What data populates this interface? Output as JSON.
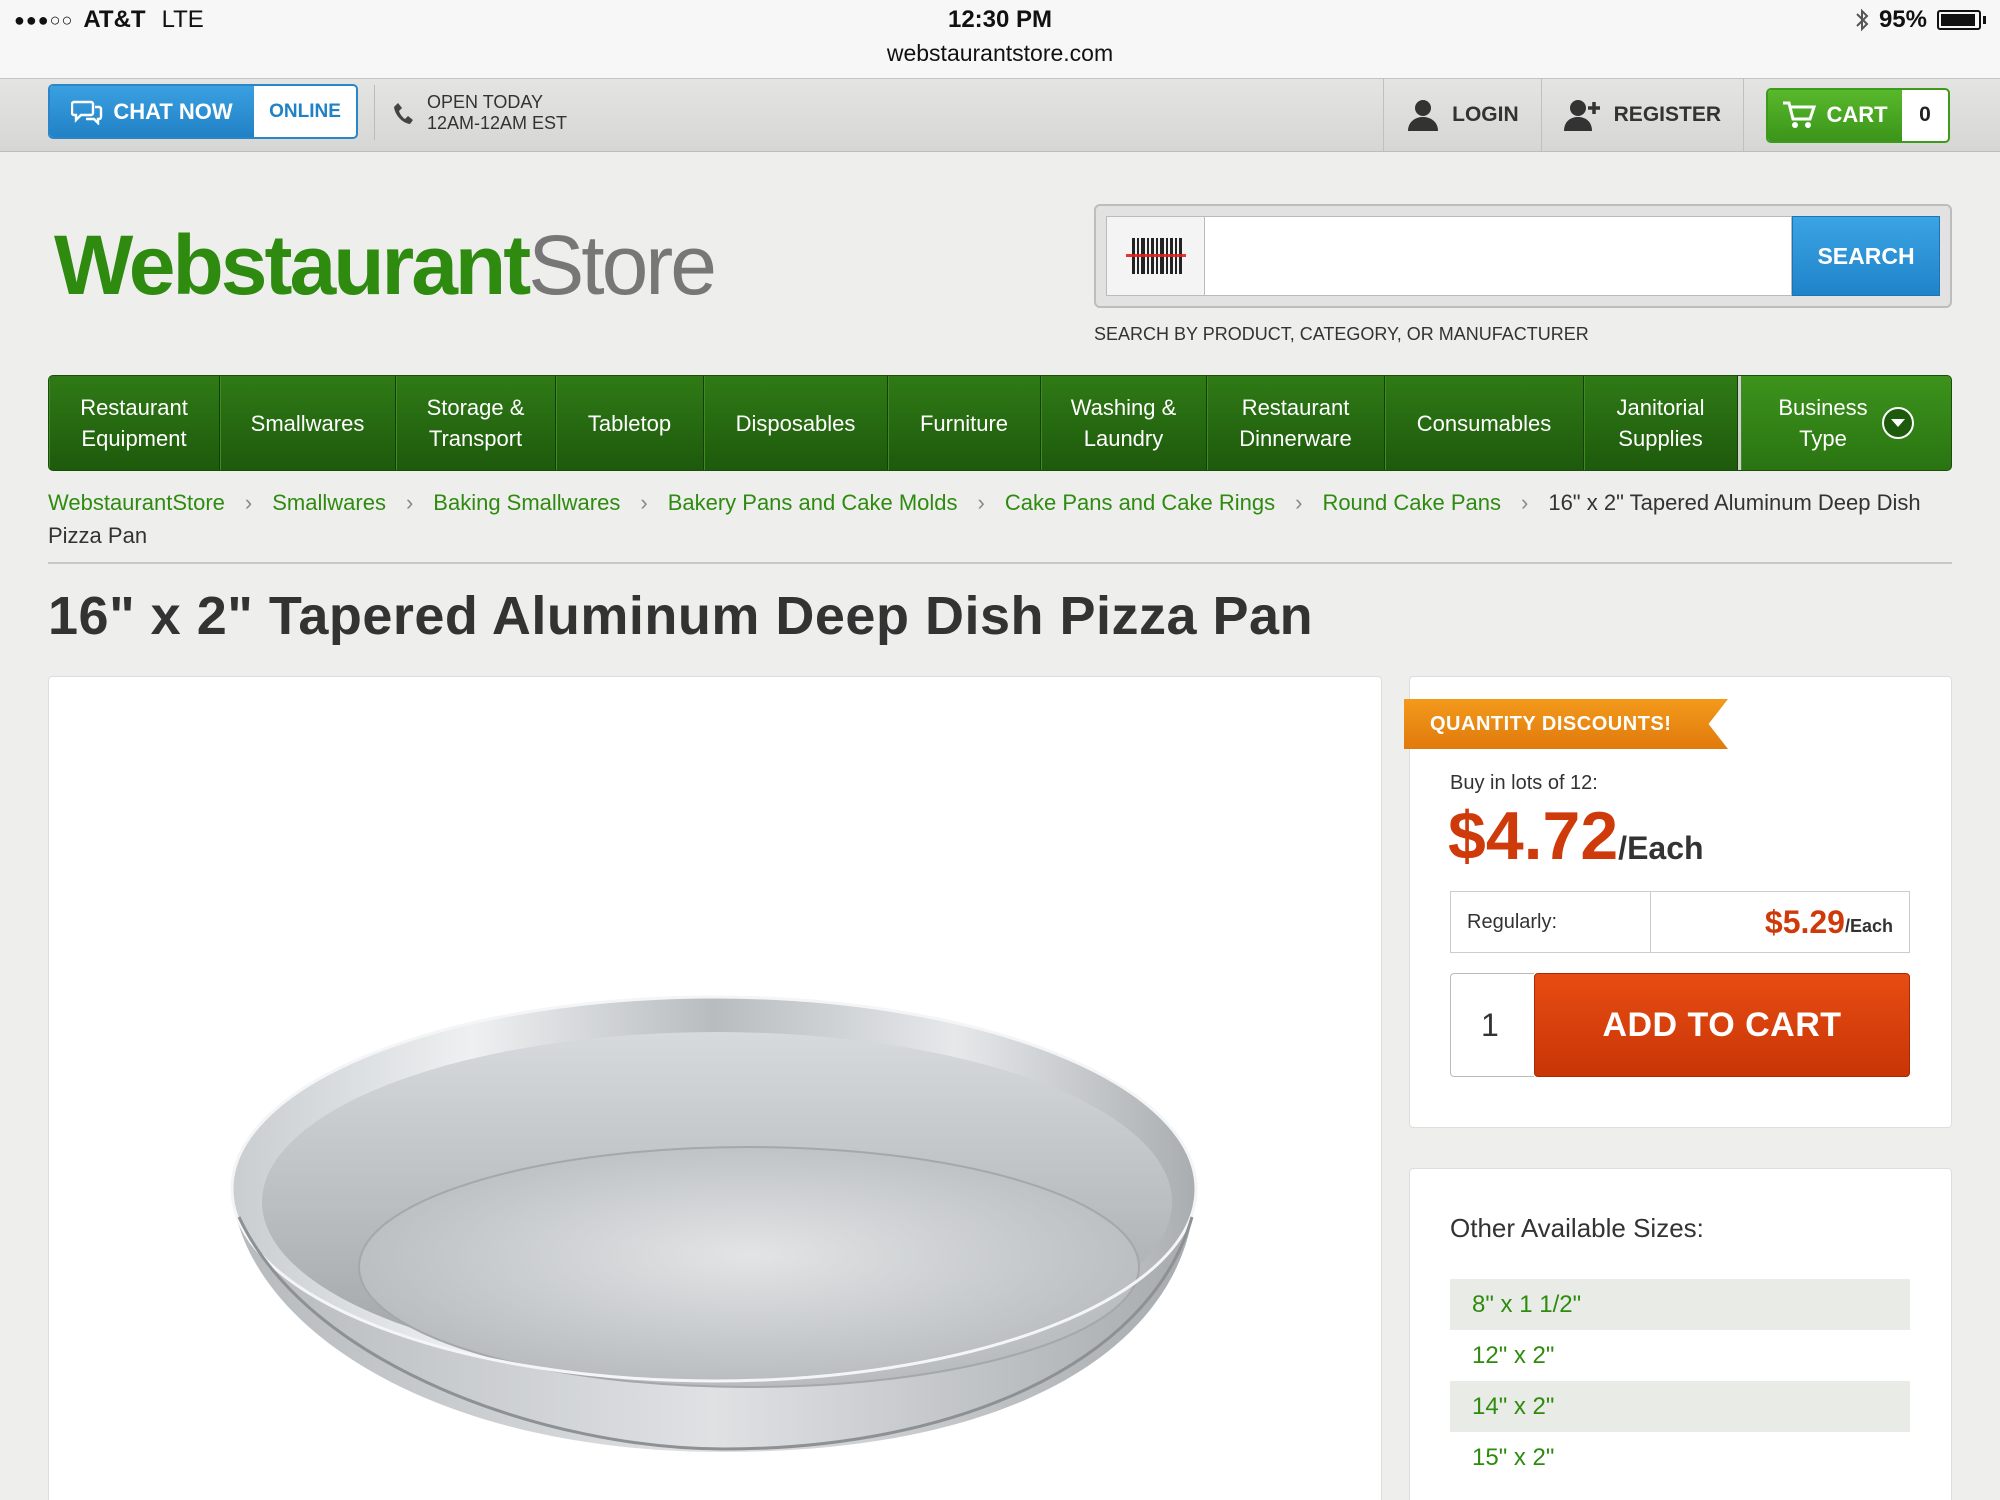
{
  "status_bar": {
    "signal": "●●●○○",
    "carrier": "AT&T",
    "network": "LTE",
    "time": "12:30 PM",
    "url": "webstaurantstore.com",
    "battery": "95%"
  },
  "utility": {
    "chat_label": "CHAT NOW",
    "chat_status": "ONLINE",
    "hours_line1": "OPEN TODAY",
    "hours_line2": "12AM-12AM EST",
    "login": "LOGIN",
    "register": "REGISTER",
    "cart_label": "CART",
    "cart_count": "0"
  },
  "header": {
    "logo_part1": "Webstaurant",
    "logo_part2": "Store",
    "search_placeholder": "",
    "search_button": "SEARCH",
    "search_hint": "SEARCH BY PRODUCT, CATEGORY, OR MANUFACTURER"
  },
  "nav": {
    "items": [
      {
        "line1": "Restaurant",
        "line2": "Equipment"
      },
      {
        "line1": "Smallwares",
        "line2": ""
      },
      {
        "line1": "Storage &",
        "line2": "Transport"
      },
      {
        "line1": "Tabletop",
        "line2": ""
      },
      {
        "line1": "Disposables",
        "line2": ""
      },
      {
        "line1": "Furniture",
        "line2": ""
      },
      {
        "line1": "Washing &",
        "line2": "Laundry"
      },
      {
        "line1": "Restaurant",
        "line2": "Dinnerware"
      },
      {
        "line1": "Consumables",
        "line2": ""
      },
      {
        "line1": "Janitorial",
        "line2": "Supplies"
      },
      {
        "line1": "Business",
        "line2": "Type"
      }
    ]
  },
  "breadcrumb": {
    "items": [
      "WebstaurantStore",
      "Smallwares",
      "Baking Smallwares",
      "Bakery Pans and Cake Molds",
      "Cake Pans and Cake Rings",
      "Round Cake Pans"
    ],
    "current": "16\" x 2\" Tapered Aluminum Deep Dish Pizza Pan"
  },
  "product": {
    "title": "16\" x 2\" Tapered Aluminum Deep Dish Pizza Pan"
  },
  "buy_box": {
    "badge": "QUANTITY DISCOUNTS!",
    "lots_text": "Buy in lots of 12:",
    "price": "$4.72",
    "price_unit": "/Each",
    "regular_label": "Regularly:",
    "regular_price": "$5.29",
    "regular_unit": "/Each",
    "quantity": "1",
    "add_to_cart": "ADD TO CART"
  },
  "sizes": {
    "title": "Other Available Sizes:",
    "items": [
      "8\" x 1 1/2\"",
      "12\" x 2\"",
      "14\" x 2\"",
      "15\" x 2\""
    ]
  },
  "colors": {
    "brand_green": "#2e8b0f",
    "accent_blue": "#2181c6",
    "price_red": "#cf3a0b",
    "badge_orange": "#f39a1c"
  }
}
